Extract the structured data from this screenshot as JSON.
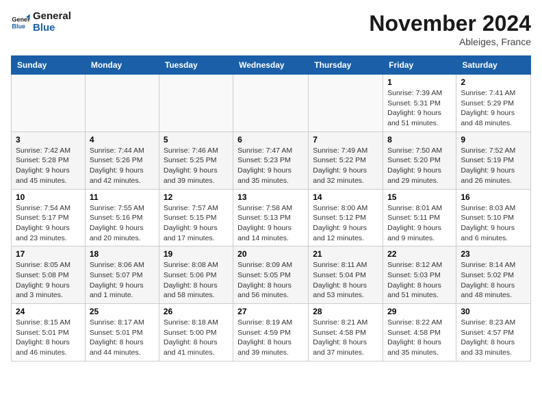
{
  "header": {
    "logo_line1": "General",
    "logo_line2": "Blue",
    "month": "November 2024",
    "location": "Ableiges, France"
  },
  "days_of_week": [
    "Sunday",
    "Monday",
    "Tuesday",
    "Wednesday",
    "Thursday",
    "Friday",
    "Saturday"
  ],
  "weeks": [
    [
      {
        "day": "",
        "info": ""
      },
      {
        "day": "",
        "info": ""
      },
      {
        "day": "",
        "info": ""
      },
      {
        "day": "",
        "info": ""
      },
      {
        "day": "",
        "info": ""
      },
      {
        "day": "1",
        "info": "Sunrise: 7:39 AM\nSunset: 5:31 PM\nDaylight: 9 hours\nand 51 minutes."
      },
      {
        "day": "2",
        "info": "Sunrise: 7:41 AM\nSunset: 5:29 PM\nDaylight: 9 hours\nand 48 minutes."
      }
    ],
    [
      {
        "day": "3",
        "info": "Sunrise: 7:42 AM\nSunset: 5:28 PM\nDaylight: 9 hours\nand 45 minutes."
      },
      {
        "day": "4",
        "info": "Sunrise: 7:44 AM\nSunset: 5:26 PM\nDaylight: 9 hours\nand 42 minutes."
      },
      {
        "day": "5",
        "info": "Sunrise: 7:46 AM\nSunset: 5:25 PM\nDaylight: 9 hours\nand 39 minutes."
      },
      {
        "day": "6",
        "info": "Sunrise: 7:47 AM\nSunset: 5:23 PM\nDaylight: 9 hours\nand 35 minutes."
      },
      {
        "day": "7",
        "info": "Sunrise: 7:49 AM\nSunset: 5:22 PM\nDaylight: 9 hours\nand 32 minutes."
      },
      {
        "day": "8",
        "info": "Sunrise: 7:50 AM\nSunset: 5:20 PM\nDaylight: 9 hours\nand 29 minutes."
      },
      {
        "day": "9",
        "info": "Sunrise: 7:52 AM\nSunset: 5:19 PM\nDaylight: 9 hours\nand 26 minutes."
      }
    ],
    [
      {
        "day": "10",
        "info": "Sunrise: 7:54 AM\nSunset: 5:17 PM\nDaylight: 9 hours\nand 23 minutes."
      },
      {
        "day": "11",
        "info": "Sunrise: 7:55 AM\nSunset: 5:16 PM\nDaylight: 9 hours\nand 20 minutes."
      },
      {
        "day": "12",
        "info": "Sunrise: 7:57 AM\nSunset: 5:15 PM\nDaylight: 9 hours\nand 17 minutes."
      },
      {
        "day": "13",
        "info": "Sunrise: 7:58 AM\nSunset: 5:13 PM\nDaylight: 9 hours\nand 14 minutes."
      },
      {
        "day": "14",
        "info": "Sunrise: 8:00 AM\nSunset: 5:12 PM\nDaylight: 9 hours\nand 12 minutes."
      },
      {
        "day": "15",
        "info": "Sunrise: 8:01 AM\nSunset: 5:11 PM\nDaylight: 9 hours\nand 9 minutes."
      },
      {
        "day": "16",
        "info": "Sunrise: 8:03 AM\nSunset: 5:10 PM\nDaylight: 9 hours\nand 6 minutes."
      }
    ],
    [
      {
        "day": "17",
        "info": "Sunrise: 8:05 AM\nSunset: 5:08 PM\nDaylight: 9 hours\nand 3 minutes."
      },
      {
        "day": "18",
        "info": "Sunrise: 8:06 AM\nSunset: 5:07 PM\nDaylight: 9 hours\nand 1 minute."
      },
      {
        "day": "19",
        "info": "Sunrise: 8:08 AM\nSunset: 5:06 PM\nDaylight: 8 hours\nand 58 minutes."
      },
      {
        "day": "20",
        "info": "Sunrise: 8:09 AM\nSunset: 5:05 PM\nDaylight: 8 hours\nand 56 minutes."
      },
      {
        "day": "21",
        "info": "Sunrise: 8:11 AM\nSunset: 5:04 PM\nDaylight: 8 hours\nand 53 minutes."
      },
      {
        "day": "22",
        "info": "Sunrise: 8:12 AM\nSunset: 5:03 PM\nDaylight: 8 hours\nand 51 minutes."
      },
      {
        "day": "23",
        "info": "Sunrise: 8:14 AM\nSunset: 5:02 PM\nDaylight: 8 hours\nand 48 minutes."
      }
    ],
    [
      {
        "day": "24",
        "info": "Sunrise: 8:15 AM\nSunset: 5:01 PM\nDaylight: 8 hours\nand 46 minutes."
      },
      {
        "day": "25",
        "info": "Sunrise: 8:17 AM\nSunset: 5:01 PM\nDaylight: 8 hours\nand 44 minutes."
      },
      {
        "day": "26",
        "info": "Sunrise: 8:18 AM\nSunset: 5:00 PM\nDaylight: 8 hours\nand 41 minutes."
      },
      {
        "day": "27",
        "info": "Sunrise: 8:19 AM\nSunset: 4:59 PM\nDaylight: 8 hours\nand 39 minutes."
      },
      {
        "day": "28",
        "info": "Sunrise: 8:21 AM\nSunset: 4:58 PM\nDaylight: 8 hours\nand 37 minutes."
      },
      {
        "day": "29",
        "info": "Sunrise: 8:22 AM\nSunset: 4:58 PM\nDaylight: 8 hours\nand 35 minutes."
      },
      {
        "day": "30",
        "info": "Sunrise: 8:23 AM\nSunset: 4:57 PM\nDaylight: 8 hours\nand 33 minutes."
      }
    ]
  ]
}
